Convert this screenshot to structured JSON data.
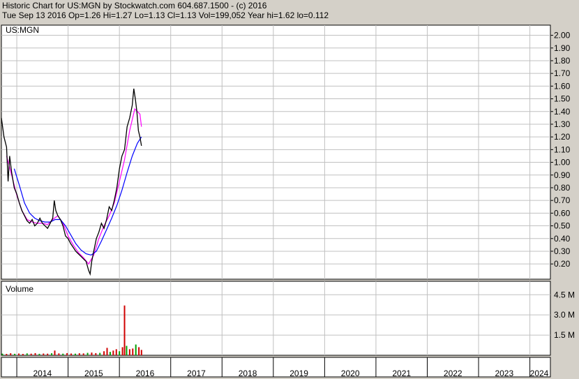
{
  "header": {
    "line1": "Historic Chart for US:MGN by Stockwatch.com 604.687.1500 - (c) 2016",
    "line2": "Tue Sep 13 2016  Op=1.26  Hi=1.27  Lo=1.13  Cl=1.13  Vol=199,052  Year hi=1.62  lo=0.112"
  },
  "colors": {
    "background": "#d4d0c8",
    "plot": "#ffffff",
    "grid": "#c0c0c0",
    "price": "#000000",
    "ma_short": "#ff00ff",
    "ma_long": "#0000ff",
    "vol_up": "#00a000",
    "vol_down": "#d00000"
  },
  "chart_data": [
    {
      "type": "line",
      "title": "US:MGN",
      "price_ticks": [
        "2.00",
        "1.90",
        "1.80",
        "1.70",
        "1.60",
        "1.50",
        "1.40",
        "1.30",
        "1.20",
        "1.10",
        "1.00",
        "0.90",
        "0.80",
        "0.70",
        "0.60",
        "0.50",
        "0.40",
        "0.30",
        "0.20"
      ],
      "ylim": [
        0.08,
        2.08
      ],
      "xlim": [
        2013.7,
        2024.4
      ],
      "year_labels": [
        "2014",
        "2015",
        "2016",
        "2017",
        "2018",
        "2019",
        "2020",
        "2021",
        "2022",
        "2023",
        "2024"
      ],
      "series": [
        {
          "name": "",
          "points": [
            [
              2013.7,
              1.35
            ],
            [
              2013.75,
              1.2
            ],
            [
              2013.8,
              1.12
            ],
            [
              2013.83,
              0.85
            ],
            [
              2013.86,
              1.05
            ],
            [
              2013.9,
              0.92
            ],
            [
              2013.95,
              0.8
            ],
            [
              2014.0,
              0.75
            ],
            [
              2014.05,
              0.68
            ],
            [
              2014.1,
              0.62
            ],
            [
              2014.15,
              0.58
            ],
            [
              2014.2,
              0.54
            ],
            [
              2014.25,
              0.52
            ],
            [
              2014.3,
              0.55
            ],
            [
              2014.35,
              0.5
            ],
            [
              2014.4,
              0.52
            ],
            [
              2014.45,
              0.56
            ],
            [
              2014.5,
              0.52
            ],
            [
              2014.55,
              0.5
            ],
            [
              2014.6,
              0.48
            ],
            [
              2014.65,
              0.52
            ],
            [
              2014.7,
              0.56
            ],
            [
              2014.73,
              0.7
            ],
            [
              2014.76,
              0.62
            ],
            [
              2014.8,
              0.58
            ],
            [
              2014.85,
              0.55
            ],
            [
              2014.9,
              0.5
            ],
            [
              2014.95,
              0.42
            ],
            [
              2015.0,
              0.4
            ],
            [
              2015.05,
              0.36
            ],
            [
              2015.1,
              0.33
            ],
            [
              2015.15,
              0.3
            ],
            [
              2015.2,
              0.28
            ],
            [
              2015.25,
              0.26
            ],
            [
              2015.3,
              0.24
            ],
            [
              2015.35,
              0.22
            ],
            [
              2015.4,
              0.15
            ],
            [
              2015.43,
              0.12
            ],
            [
              2015.46,
              0.22
            ],
            [
              2015.5,
              0.3
            ],
            [
              2015.55,
              0.4
            ],
            [
              2015.6,
              0.45
            ],
            [
              2015.65,
              0.52
            ],
            [
              2015.7,
              0.48
            ],
            [
              2015.75,
              0.55
            ],
            [
              2015.8,
              0.65
            ],
            [
              2015.85,
              0.62
            ],
            [
              2015.9,
              0.7
            ],
            [
              2015.95,
              0.8
            ],
            [
              2016.0,
              0.95
            ],
            [
              2016.05,
              1.05
            ],
            [
              2016.1,
              1.1
            ],
            [
              2016.15,
              1.28
            ],
            [
              2016.2,
              1.35
            ],
            [
              2016.25,
              1.45
            ],
            [
              2016.28,
              1.58
            ],
            [
              2016.31,
              1.5
            ],
            [
              2016.34,
              1.4
            ],
            [
              2016.37,
              1.25
            ],
            [
              2016.4,
              1.2
            ],
            [
              2016.43,
              1.13
            ]
          ]
        },
        {
          "name": "",
          "style": "ma_short",
          "points": [
            [
              2013.8,
              1.05
            ],
            [
              2013.9,
              0.9
            ],
            [
              2014.0,
              0.74
            ],
            [
              2014.1,
              0.62
            ],
            [
              2014.2,
              0.55
            ],
            [
              2014.3,
              0.53
            ],
            [
              2014.4,
              0.52
            ],
            [
              2014.5,
              0.52
            ],
            [
              2014.6,
              0.51
            ],
            [
              2014.7,
              0.55
            ],
            [
              2014.8,
              0.58
            ],
            [
              2014.9,
              0.52
            ],
            [
              2015.0,
              0.42
            ],
            [
              2015.1,
              0.35
            ],
            [
              2015.2,
              0.29
            ],
            [
              2015.3,
              0.25
            ],
            [
              2015.4,
              0.2
            ],
            [
              2015.5,
              0.27
            ],
            [
              2015.6,
              0.4
            ],
            [
              2015.7,
              0.5
            ],
            [
              2015.8,
              0.58
            ],
            [
              2015.9,
              0.68
            ],
            [
              2016.0,
              0.85
            ],
            [
              2016.1,
              1.02
            ],
            [
              2016.2,
              1.25
            ],
            [
              2016.3,
              1.42
            ],
            [
              2016.4,
              1.38
            ],
            [
              2016.43,
              1.28
            ]
          ]
        },
        {
          "name": "",
          "style": "ma_long",
          "points": [
            [
              2013.95,
              0.95
            ],
            [
              2014.05,
              0.82
            ],
            [
              2014.15,
              0.68
            ],
            [
              2014.25,
              0.6
            ],
            [
              2014.35,
              0.56
            ],
            [
              2014.45,
              0.54
            ],
            [
              2014.55,
              0.53
            ],
            [
              2014.65,
              0.53
            ],
            [
              2014.75,
              0.55
            ],
            [
              2014.85,
              0.55
            ],
            [
              2014.95,
              0.5
            ],
            [
              2015.05,
              0.43
            ],
            [
              2015.15,
              0.36
            ],
            [
              2015.25,
              0.31
            ],
            [
              2015.35,
              0.28
            ],
            [
              2015.45,
              0.27
            ],
            [
              2015.55,
              0.3
            ],
            [
              2015.65,
              0.38
            ],
            [
              2015.75,
              0.47
            ],
            [
              2015.85,
              0.56
            ],
            [
              2015.95,
              0.66
            ],
            [
              2016.05,
              0.78
            ],
            [
              2016.15,
              0.92
            ],
            [
              2016.25,
              1.05
            ],
            [
              2016.35,
              1.15
            ],
            [
              2016.43,
              1.2
            ]
          ]
        }
      ]
    },
    {
      "type": "bar",
      "title": "Volume",
      "vol_ticks": [
        "4.5 M",
        "3.0 M",
        "1.5 M"
      ],
      "vol_tick_values": [
        4.5,
        3.0,
        1.5
      ],
      "ylim": [
        0,
        5.5
      ],
      "bars": [
        [
          2013.72,
          0.12
        ],
        [
          2013.8,
          0.1
        ],
        [
          2013.88,
          0.15
        ],
        [
          2013.96,
          0.11
        ],
        [
          2014.04,
          0.13
        ],
        [
          2014.12,
          0.1
        ],
        [
          2014.2,
          0.14
        ],
        [
          2014.28,
          0.12
        ],
        [
          2014.36,
          0.16
        ],
        [
          2014.44,
          0.11
        ],
        [
          2014.52,
          0.13
        ],
        [
          2014.6,
          0.12
        ],
        [
          2014.68,
          0.15
        ],
        [
          2014.74,
          0.35
        ],
        [
          2014.82,
          0.14
        ],
        [
          2014.9,
          0.12
        ],
        [
          2014.98,
          0.16
        ],
        [
          2015.06,
          0.13
        ],
        [
          2015.14,
          0.12
        ],
        [
          2015.22,
          0.15
        ],
        [
          2015.3,
          0.14
        ],
        [
          2015.38,
          0.18
        ],
        [
          2015.46,
          0.2
        ],
        [
          2015.54,
          0.16
        ],
        [
          2015.62,
          0.18
        ],
        [
          2015.7,
          0.3
        ],
        [
          2015.76,
          0.55
        ],
        [
          2015.82,
          0.25
        ],
        [
          2015.88,
          0.35
        ],
        [
          2015.94,
          0.45
        ],
        [
          2016.0,
          0.3
        ],
        [
          2016.06,
          0.6
        ],
        [
          2016.1,
          3.7
        ],
        [
          2016.14,
          0.7
        ],
        [
          2016.2,
          0.45
        ],
        [
          2016.26,
          0.5
        ],
        [
          2016.32,
          0.8
        ],
        [
          2016.38,
          0.6
        ],
        [
          2016.43,
          0.4
        ]
      ]
    }
  ]
}
